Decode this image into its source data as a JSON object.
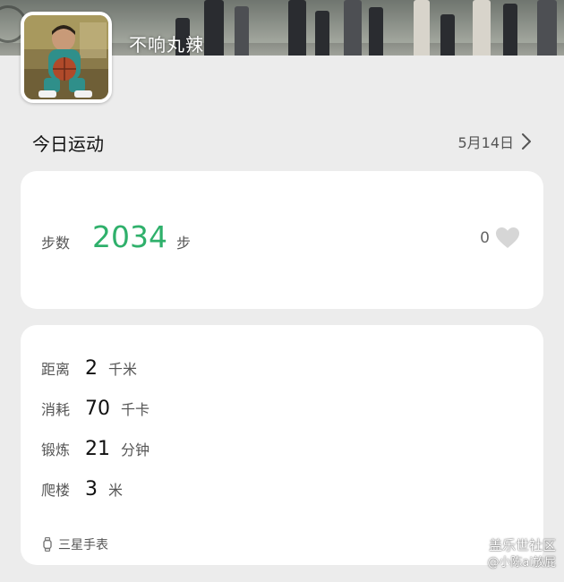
{
  "profile": {
    "username": "不响丸辣"
  },
  "activity": {
    "section_title": "今日运动",
    "date": "5月14日"
  },
  "steps": {
    "label": "步数",
    "value": "2034",
    "unit": "步",
    "likes": "0"
  },
  "stats": [
    {
      "label": "距离",
      "value": "2",
      "unit": "千米"
    },
    {
      "label": "消耗",
      "value": "70",
      "unit": "千卡"
    },
    {
      "label": "锻炼",
      "value": "21",
      "unit": "分钟"
    },
    {
      "label": "爬楼",
      "value": "3",
      "unit": "米"
    }
  ],
  "device": {
    "name": "三星手表"
  },
  "watermark": {
    "line1": "盖乐世社区",
    "line2": "@小陈ai放屁"
  },
  "colors": {
    "steps_accent": "#2fb06b",
    "background": "#ececec",
    "card": "#ffffff"
  },
  "icons": {
    "date_chevron": "chevron-right-icon",
    "like": "heart-icon",
    "device": "watch-icon"
  }
}
